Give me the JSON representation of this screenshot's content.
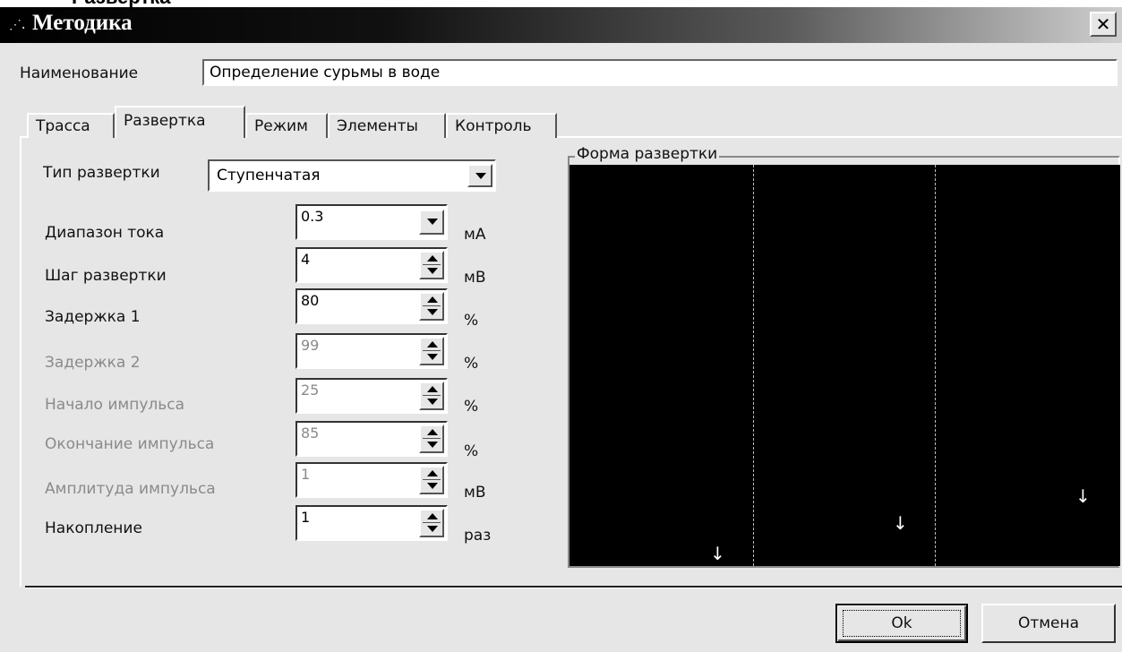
{
  "above_caption": "Развертка",
  "window": {
    "title": "Методика",
    "close_label": "✕"
  },
  "name": {
    "label": "Наименование",
    "value": "Определение сурьмы в воде"
  },
  "tabs": [
    {
      "label": "Трасса"
    },
    {
      "label": "Развертка",
      "active": true
    },
    {
      "label": "Режим"
    },
    {
      "label": "Элементы"
    },
    {
      "label": "Контроль"
    }
  ],
  "sweep_type": {
    "label": "Тип развертки",
    "value": "Ступенчатая"
  },
  "fields": [
    {
      "label": "Диапазон тока",
      "value": "0.3",
      "unit": "мА",
      "kind": "combo",
      "enabled": true
    },
    {
      "label": "Шаг развертки",
      "value": "4",
      "unit": "мВ",
      "kind": "spin",
      "enabled": true
    },
    {
      "label": "Задержка 1",
      "value": "80",
      "unit": "%",
      "kind": "spin",
      "enabled": true
    },
    {
      "label": "Задержка 2",
      "value": "99",
      "unit": "%",
      "kind": "spin",
      "enabled": false
    },
    {
      "label": "Начало импульса",
      "value": "25",
      "unit": "%",
      "kind": "spin",
      "enabled": false
    },
    {
      "label": "Окончание импульса",
      "value": "85",
      "unit": "%",
      "kind": "spin",
      "enabled": false
    },
    {
      "label": "Амплитуда импульса",
      "value": "1",
      "unit": "мВ",
      "kind": "spin",
      "enabled": false
    },
    {
      "label": "Накопление",
      "value": "1",
      "unit": "раз",
      "kind": "spin",
      "enabled": true
    }
  ],
  "preview": {
    "title": "Форма развертки",
    "arrow_glyph": "↓"
  },
  "buttons": {
    "ok": "Ok",
    "cancel": "Отмена"
  }
}
